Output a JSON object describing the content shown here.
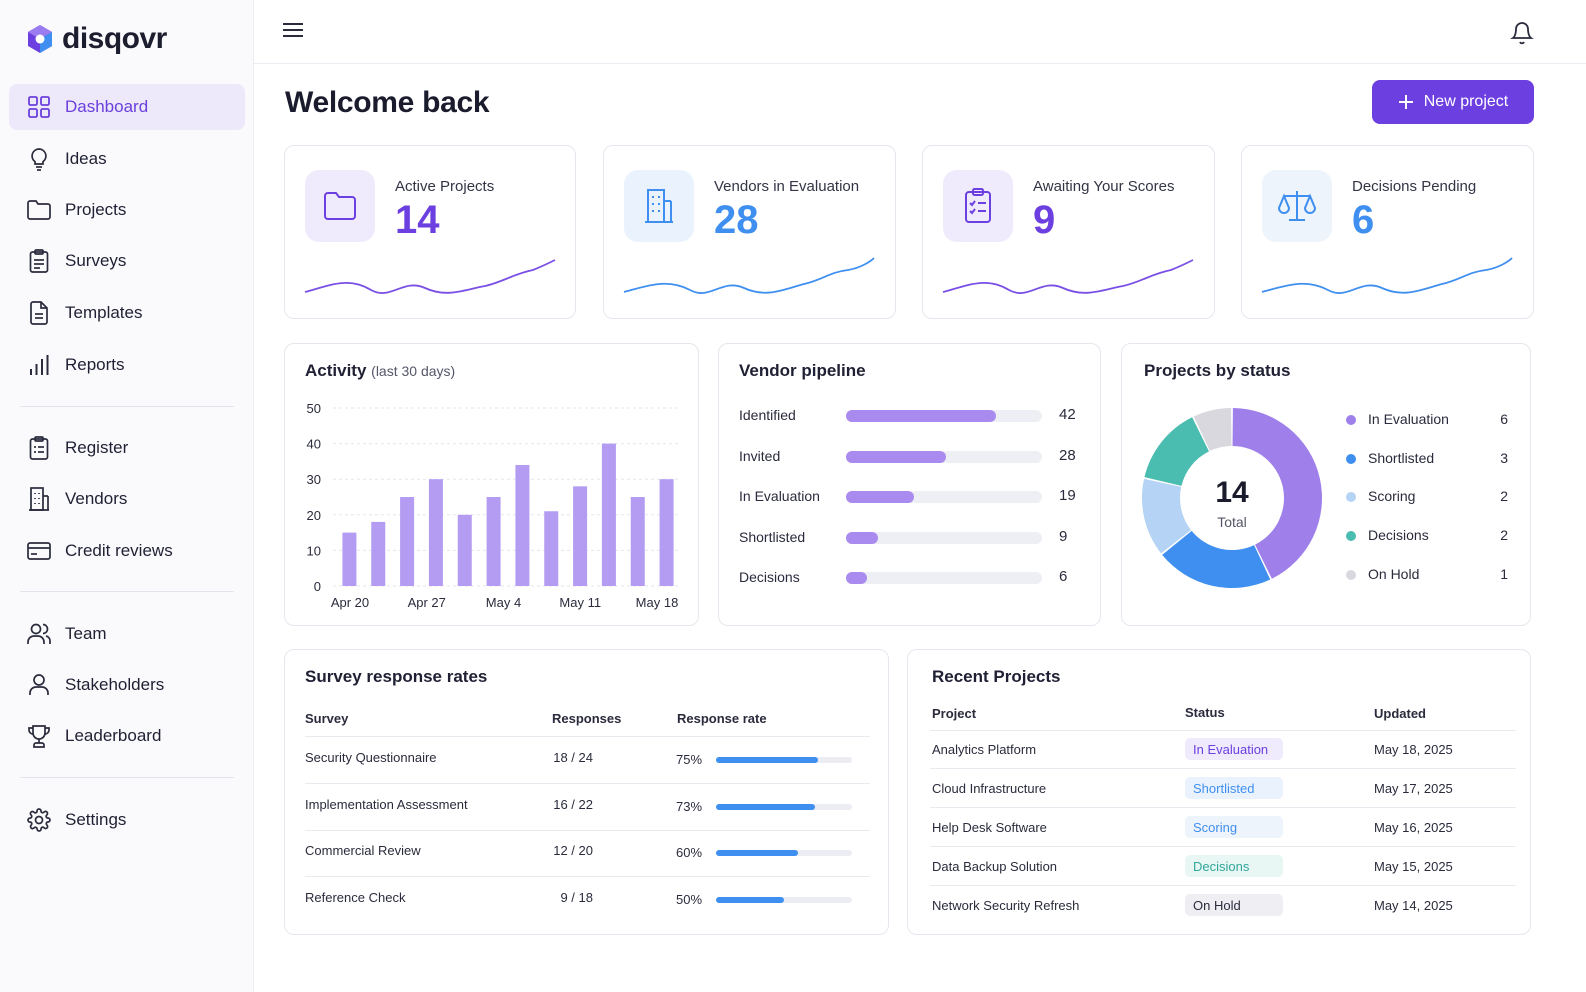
{
  "app": {
    "name": "disqovr"
  },
  "sidebar": {
    "items": [
      {
        "label": "Dashboard",
        "icon": "grid-icon"
      },
      {
        "label": "Ideas",
        "icon": "lightbulb-icon"
      },
      {
        "label": "Projects",
        "icon": "folder-icon"
      },
      {
        "label": "Surveys",
        "icon": "clipboard-icon"
      },
      {
        "label": "Templates",
        "icon": "document-icon"
      },
      {
        "label": "Reports",
        "icon": "bar-chart-icon"
      },
      {
        "label": "Register",
        "icon": "clipboard-list-icon"
      },
      {
        "label": "Vendors",
        "icon": "building-icon"
      },
      {
        "label": "Credit reviews",
        "icon": "credit-card-icon"
      },
      {
        "label": "Team",
        "icon": "users-icon"
      },
      {
        "label": "Stakeholders",
        "icon": "user-icon"
      },
      {
        "label": "Leaderboard",
        "icon": "trophy-icon"
      },
      {
        "label": "Settings",
        "icon": "gear-icon"
      }
    ]
  },
  "header": {
    "title": "Welcome back",
    "new_project_label": "New project"
  },
  "stats": [
    {
      "label": "Active Projects",
      "value": "14",
      "color": "#6c3fe0",
      "icon": "folder-icon"
    },
    {
      "label": "Vendors in Evaluation",
      "value": "28",
      "color": "#3f8ff0",
      "icon": "building-icon"
    },
    {
      "label": "Awaiting Your Scores",
      "value": "9",
      "color": "#6c3fe0",
      "icon": "clipboard-check-icon"
    },
    {
      "label": "Decisions Pending",
      "value": "6",
      "color": "#3f8ff0",
      "icon": "scale-icon"
    }
  ],
  "activity": {
    "title": "Activity",
    "subtitle": "(last 30 days)",
    "chart_data": {
      "type": "bar",
      "x_tick_labels": [
        "Apr 20",
        "Apr 27",
        "May 4",
        "May 11",
        "May 18"
      ],
      "values": [
        15,
        18,
        25,
        30,
        20,
        25,
        34,
        21,
        28,
        40,
        25,
        30
      ],
      "ylim": [
        0,
        50
      ],
      "y_ticks": [
        "50",
        "40",
        "30",
        "20",
        "10",
        "0"
      ],
      "grid": true,
      "color": "#b49cf2"
    }
  },
  "pipeline": {
    "title": "Vendor pipeline",
    "chart_data": {
      "type": "bar",
      "orientation": "horizontal",
      "categories": [
        "Identified",
        "Invited",
        "In Evaluation",
        "Shortlisted",
        "Decisions"
      ],
      "values": [
        42,
        28,
        19,
        9,
        6
      ],
      "labels": [
        "42",
        "28",
        "19",
        "9",
        "6"
      ],
      "max": 55
    }
  },
  "status": {
    "title": "Projects by status",
    "total": "14",
    "total_label": "Total",
    "chart_data": {
      "type": "pie",
      "categories": [
        "In Evaluation",
        "Shortlisted",
        "Scoring",
        "Decisions",
        "On Hold"
      ],
      "values": [
        6,
        3,
        2,
        2,
        1
      ],
      "labels": [
        "6",
        "3",
        "2",
        "2",
        "1"
      ],
      "colors": [
        "#9f7fea",
        "#3f8ff0",
        "#b5d3f5",
        "#4bbcb0",
        "#d8d8de"
      ]
    }
  },
  "survey": {
    "title": "Survey response rates",
    "columns": [
      "Survey",
      "Responses",
      "Response rate"
    ],
    "rows": [
      {
        "name": "Security Questionnaire",
        "responses": "18 / 24",
        "rate_label": "75%",
        "rate": 0.75
      },
      {
        "name": "Implementation Assessment",
        "responses": "16 / 22",
        "rate_label": "73%",
        "rate": 0.73
      },
      {
        "name": "Commercial Review",
        "responses": "12 / 20",
        "rate_label": "60%",
        "rate": 0.6
      },
      {
        "name": "Reference Check",
        "responses": "9 / 18",
        "rate_label": "50%",
        "rate": 0.5
      }
    ]
  },
  "recent": {
    "title": "Recent Projects",
    "columns": [
      "Project",
      "Status",
      "Updated"
    ],
    "rows": [
      {
        "project": "Analytics Platform",
        "status": "In Evaluation",
        "updated": "May 18, 2025",
        "fg": "#6c3fe0",
        "bg": "#efeafc"
      },
      {
        "project": "Cloud Infrastructure",
        "status": "Shortlisted",
        "updated": "May 17, 2025",
        "fg": "#3f8ff0",
        "bg": "#eaf3fd"
      },
      {
        "project": "Help Desk Software",
        "status": "Scoring",
        "updated": "May 16, 2025",
        "fg": "#3f8ff0",
        "bg": "#eef4fb"
      },
      {
        "project": "Data Backup Solution",
        "status": "Decisions",
        "updated": "May 15, 2025",
        "fg": "#2fa79a",
        "bg": "#e8f6f4"
      },
      {
        "project": "Network Security Refresh",
        "status": "On Hold",
        "updated": "May 14, 2025",
        "fg": "#2a2b3c",
        "bg": "#efeff3"
      }
    ]
  }
}
